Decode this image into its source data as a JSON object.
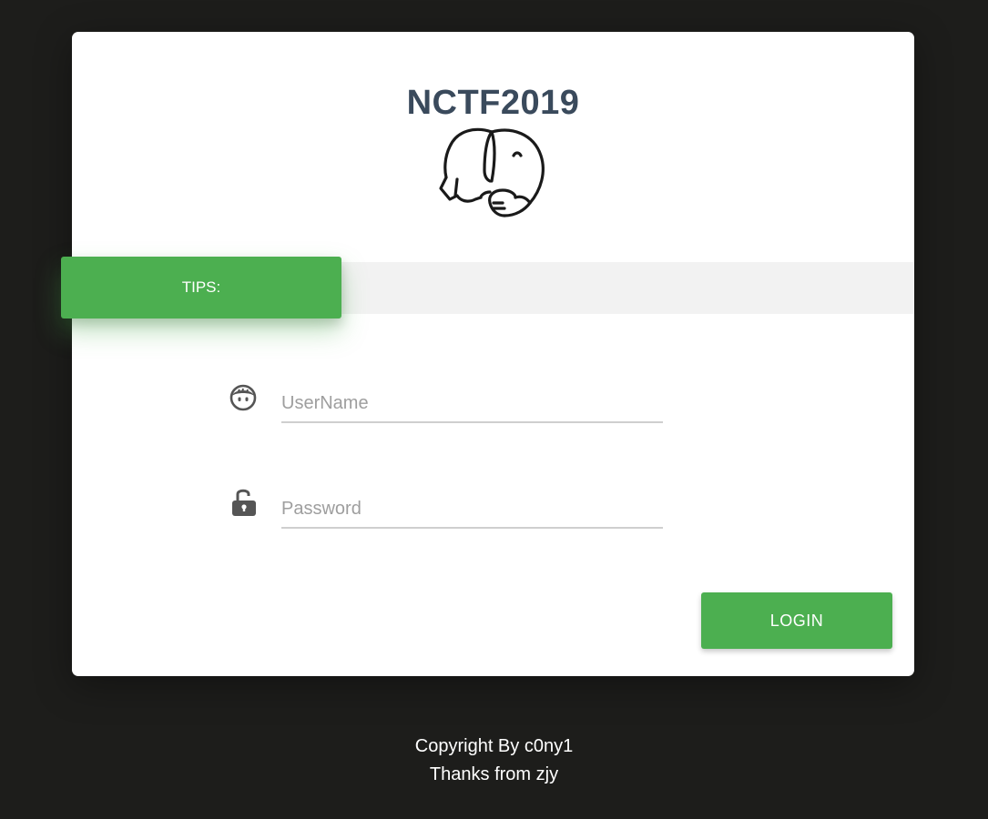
{
  "header": {
    "title": "NCTF2019",
    "logo_icon": "elephant-icon"
  },
  "tips": {
    "label": "TIPS:",
    "message": ""
  },
  "form": {
    "username": {
      "icon": "user-face-icon",
      "placeholder": "UserName",
      "value": ""
    },
    "password": {
      "icon": "unlock-icon",
      "placeholder": "Password",
      "value": ""
    },
    "login_label": "LOGIN"
  },
  "footer": {
    "line1": "Copyright By c0ny1",
    "line2": "Thanks from zjy"
  },
  "colors": {
    "background": "#1d1d1b",
    "card": "#ffffff",
    "accent": "#4caf50",
    "title": "#3a4a5c"
  }
}
